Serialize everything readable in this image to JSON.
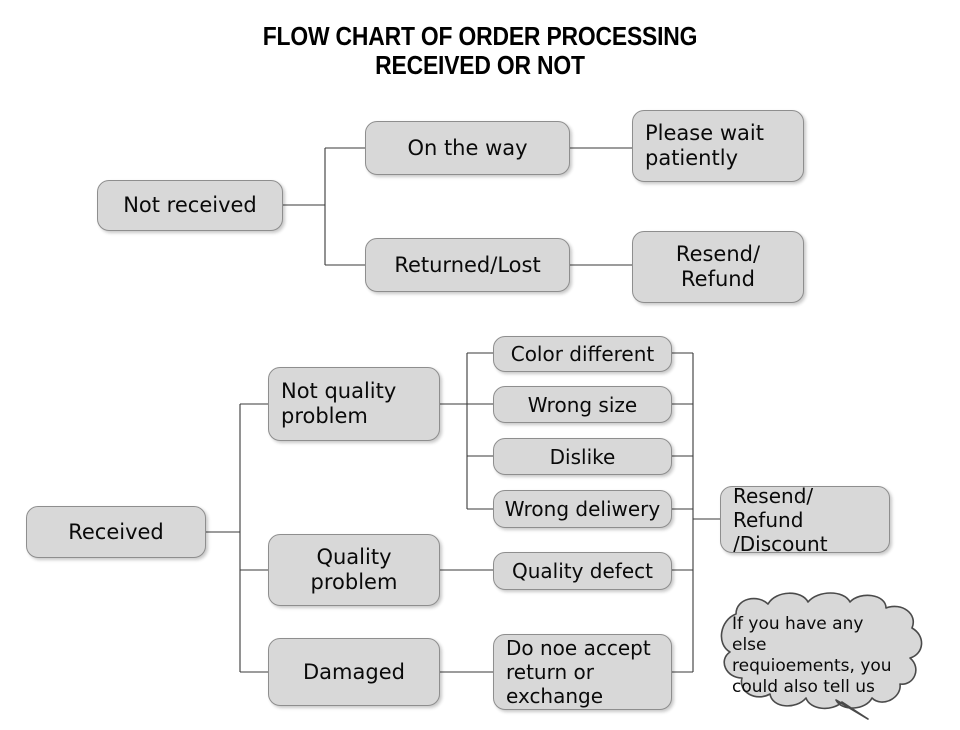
{
  "title": {
    "line1": "FLOW CHART OF ORDER PROCESSING",
    "line2": "RECEIVED OR NOT"
  },
  "colors": {
    "node_fill": "#d8d8d8",
    "node_border": "#8e8e8e",
    "connector": "#3a3a3a",
    "text": "#0a0a0a",
    "background": "#ffffff"
  },
  "nodes": {
    "not_received": "Not received",
    "on_the_way": "On the way",
    "please_wait": "Please wait\npatiently",
    "returned_lost": "Returned/Lost",
    "resend_refund": "Resend/\nRefund",
    "received": "Received",
    "not_quality_problem": "Not quality\nproblem",
    "quality_problem": "Quality\nproblem",
    "damaged": "Damaged",
    "color_different": "Color different",
    "wrong_size": "Wrong size",
    "dislike": "Dislike",
    "wrong_deliwery": "Wrong deliwery",
    "quality_defect": "Quality defect",
    "do_not_accept": "Do noe accept\nreturn or\nexchange",
    "resend_refund_discount": "Resend/ Refund\n/Discount"
  },
  "callout": {
    "text": "If you have any else\nrequioements, you\ncould also tell us"
  },
  "chart_data": {
    "type": "diagram",
    "title": "FLOW CHART OF ORDER PROCESSING RECEIVED OR NOT",
    "subtitle": "",
    "diagram_kind": "flowchart-tree",
    "orientation": "left-to-right",
    "trees": [
      {
        "root": "Not received",
        "branches": [
          {
            "node": "On the way",
            "leads_to": [
              "Please wait patiently"
            ]
          },
          {
            "node": "Returned/Lost",
            "leads_to": [
              "Resend/ Refund"
            ]
          }
        ]
      },
      {
        "root": "Received",
        "branches": [
          {
            "node": "Not quality problem",
            "leads_to": [
              "Color different",
              "Wrong size",
              "Dislike",
              "Wrong deliwery"
            ]
          },
          {
            "node": "Quality problem",
            "leads_to": [
              "Quality defect"
            ]
          },
          {
            "node": "Damaged",
            "leads_to": [
              "Do noe accept return or exchange"
            ]
          }
        ],
        "merge_node": "Resend/ Refund /Discount",
        "merge_sources": [
          "Color different",
          "Wrong size",
          "Dislike",
          "Wrong deliwery",
          "Quality defect",
          "Do noe accept return or exchange"
        ]
      }
    ],
    "annotations": [
      "If you have any else requioements, you could also tell us"
    ]
  }
}
